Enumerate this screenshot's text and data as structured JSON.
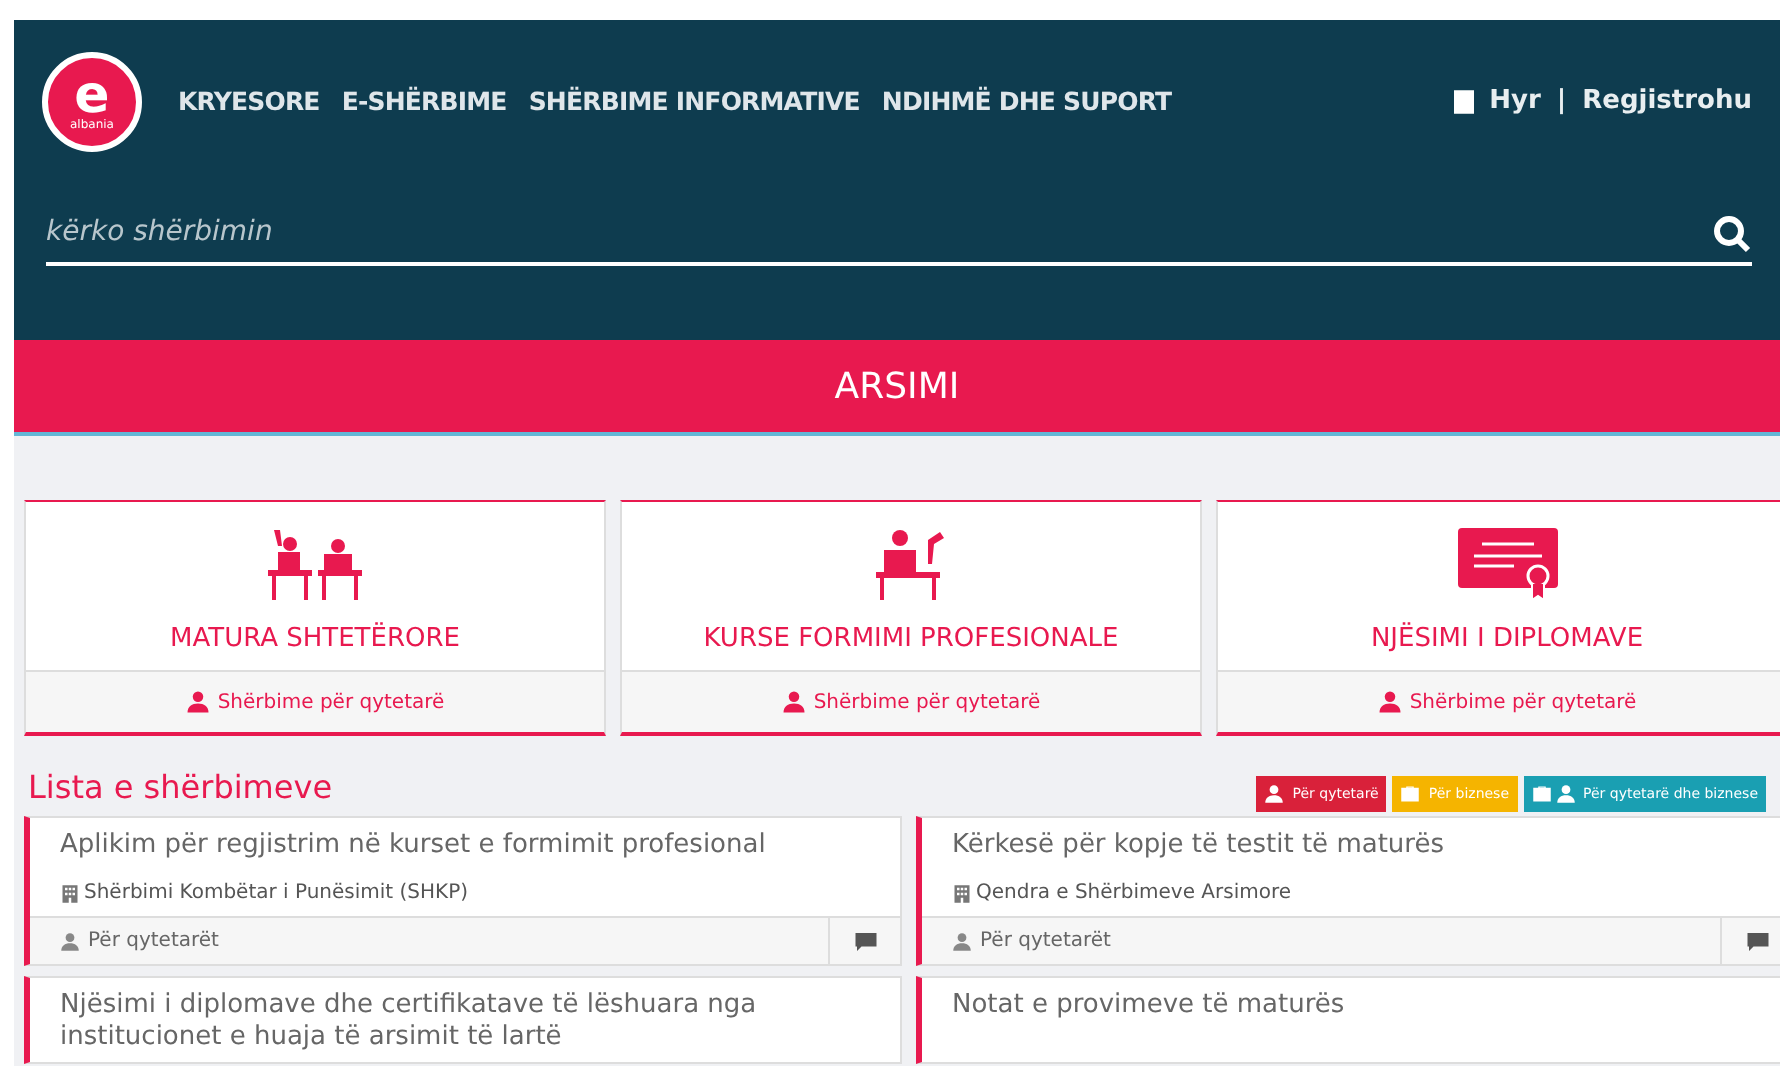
{
  "header": {
    "logo": {
      "letter": "e",
      "caption": "albania"
    },
    "nav": [
      "KRYESORE",
      "E-SHËRBIME",
      "SHËRBIME INFORMATIVE",
      "NDIHMË DHE SUPORT"
    ],
    "login": "Hyr",
    "separator": "|",
    "register": "Regjistrohu",
    "search": {
      "placeholder": "kërko shërbimin"
    }
  },
  "banner": {
    "title": "ARSIMI"
  },
  "categories": [
    {
      "kind": "students",
      "title": "MATURA SHTETËRORE",
      "audience": "Shërbime për qytetarë"
    },
    {
      "kind": "teacher",
      "title": "KURSE FORMIMI PROFESIONALE",
      "audience": "Shërbime për qytetarë"
    },
    {
      "kind": "certificate",
      "title": "NJËSIMI I DIPLOMAVE",
      "audience": "Shërbime për qytetarë"
    }
  ],
  "services": {
    "title": "Lista e shërbimeve",
    "legend": [
      {
        "kind": "citizen",
        "label": "Për qytetarë",
        "color": "#d9213a"
      },
      {
        "kind": "business",
        "label": "Për biznese",
        "color": "#f5b400"
      },
      {
        "kind": "both",
        "label": "Për qytetarë dhe biznese",
        "color": "#1a9fb2"
      }
    ],
    "items": [
      {
        "title": "Aplikim për regjistrim në kurset e formimit profesional",
        "institution": "Shërbimi Kombëtar i Punësimit (SHKP)",
        "audience": "Për qytetarët"
      },
      {
        "title": "Kërkesë për kopje të testit të maturës",
        "institution": "Qendra e Shërbimeve Arsimore",
        "audience": "Për qytetarët"
      },
      {
        "title": "Njësimi i diplomave dhe certifikatave të lëshuara nga institucionet e huaja të arsimit të lartë"
      },
      {
        "title": "Notat e provimeve të maturës"
      }
    ]
  }
}
